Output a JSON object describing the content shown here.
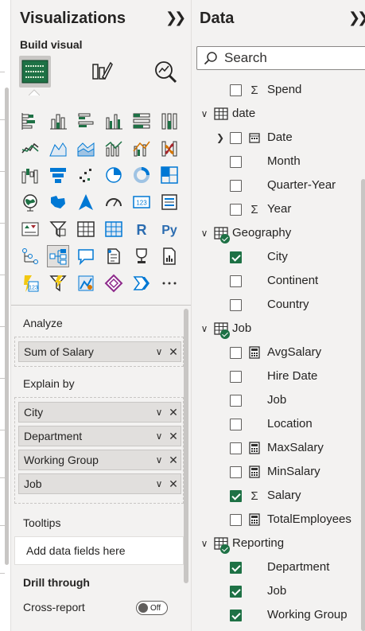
{
  "visualizations": {
    "title": "Visualizations",
    "build_visual_label": "Build visual",
    "icons": [
      "stacked-bar-chart-icon",
      "stacked-column-chart-icon",
      "clustered-bar-chart-icon",
      "clustered-column-chart-icon",
      "100-stacked-bar-chart-icon",
      "100-stacked-column-chart-icon",
      "line-chart-icon",
      "area-chart-icon",
      "stacked-area-chart-icon",
      "line-and-stacked-column-chart-icon",
      "line-and-clustered-column-chart-icon",
      "ribbon-chart-icon",
      "waterfall-chart-icon",
      "funnel-icon",
      "scatter-chart-icon",
      "pie-chart-icon",
      "donut-chart-icon",
      "treemap-icon",
      "map-icon",
      "filled-map-icon",
      "azure-map-icon",
      "gauge-icon",
      "card-icon",
      "multi-row-card-icon",
      "kpi-icon",
      "slicer-icon",
      "table-icon",
      "matrix-icon",
      "r-visual-icon",
      "python-visual-icon",
      "key-influencers-icon",
      "decomposition-tree-icon",
      "qa-icon",
      "smart-narrative-icon",
      "goals-icon",
      "paginated-report-icon",
      "power-apps-icon",
      "power-automate-icon",
      "arcgis-map-icon",
      "diamond-visual-icon",
      "chevron-visual-icon",
      "more-visuals-icon"
    ],
    "selected_icon_index": 31,
    "analyze": {
      "label": "Analyze",
      "fields": [
        "Sum of Salary"
      ]
    },
    "explain_by": {
      "label": "Explain by",
      "fields": [
        "City",
        "Department",
        "Working Group",
        "Job"
      ]
    },
    "tooltips": {
      "label": "Tooltips",
      "placeholder": "Add data fields here"
    },
    "drill_through": {
      "label": "Drill through",
      "cross_report_label": "Cross-report",
      "cross_report_state": "Off"
    }
  },
  "data_pane": {
    "title": "Data",
    "search_placeholder": "Search",
    "rows": [
      {
        "kind": "field",
        "name": "Spend",
        "type": "sigma",
        "checked": false,
        "level": 1
      },
      {
        "kind": "table",
        "name": "date",
        "expanded": true,
        "has_check": false,
        "icon": "date-table"
      },
      {
        "kind": "hierarchy",
        "name": "Date",
        "type": "calendar",
        "checked": false,
        "level": 1
      },
      {
        "kind": "field",
        "name": "Month",
        "type": "",
        "checked": false,
        "level": 1
      },
      {
        "kind": "field",
        "name": "Quarter-Year",
        "type": "",
        "checked": false,
        "level": 1
      },
      {
        "kind": "field",
        "name": "Year",
        "type": "sigma",
        "checked": false,
        "level": 1
      },
      {
        "kind": "table",
        "name": "Geography",
        "expanded": true,
        "has_check": true,
        "icon": "table"
      },
      {
        "kind": "field",
        "name": "City",
        "type": "",
        "checked": true,
        "level": 1
      },
      {
        "kind": "field",
        "name": "Continent",
        "type": "",
        "checked": false,
        "level": 1
      },
      {
        "kind": "field",
        "name": "Country",
        "type": "",
        "checked": false,
        "level": 1
      },
      {
        "kind": "table",
        "name": "Job",
        "expanded": true,
        "has_check": true,
        "icon": "table"
      },
      {
        "kind": "field",
        "name": "AvgSalary",
        "type": "calc",
        "checked": false,
        "level": 1
      },
      {
        "kind": "field",
        "name": "Hire Date",
        "type": "",
        "checked": false,
        "level": 1
      },
      {
        "kind": "field",
        "name": "Job",
        "type": "",
        "checked": false,
        "level": 1
      },
      {
        "kind": "field",
        "name": "Location",
        "type": "",
        "checked": false,
        "level": 1
      },
      {
        "kind": "field",
        "name": "MaxSalary",
        "type": "calc",
        "checked": false,
        "level": 1
      },
      {
        "kind": "field",
        "name": "MinSalary",
        "type": "calc",
        "checked": false,
        "level": 1
      },
      {
        "kind": "field",
        "name": "Salary",
        "type": "sigma",
        "checked": true,
        "level": 1
      },
      {
        "kind": "field",
        "name": "TotalEmployees",
        "type": "calc",
        "checked": false,
        "level": 1
      },
      {
        "kind": "table",
        "name": "Reporting",
        "expanded": true,
        "has_check": true,
        "icon": "table"
      },
      {
        "kind": "field",
        "name": "Department",
        "type": "",
        "checked": true,
        "level": 1
      },
      {
        "kind": "field",
        "name": "Job",
        "type": "",
        "checked": true,
        "level": 1
      },
      {
        "kind": "field",
        "name": "Working Group",
        "type": "",
        "checked": true,
        "level": 1
      }
    ]
  },
  "colors": {
    "accent_green": "#1e7145",
    "pane_bg": "#f3f2f1",
    "selected_bg": "#c8c6c4"
  }
}
